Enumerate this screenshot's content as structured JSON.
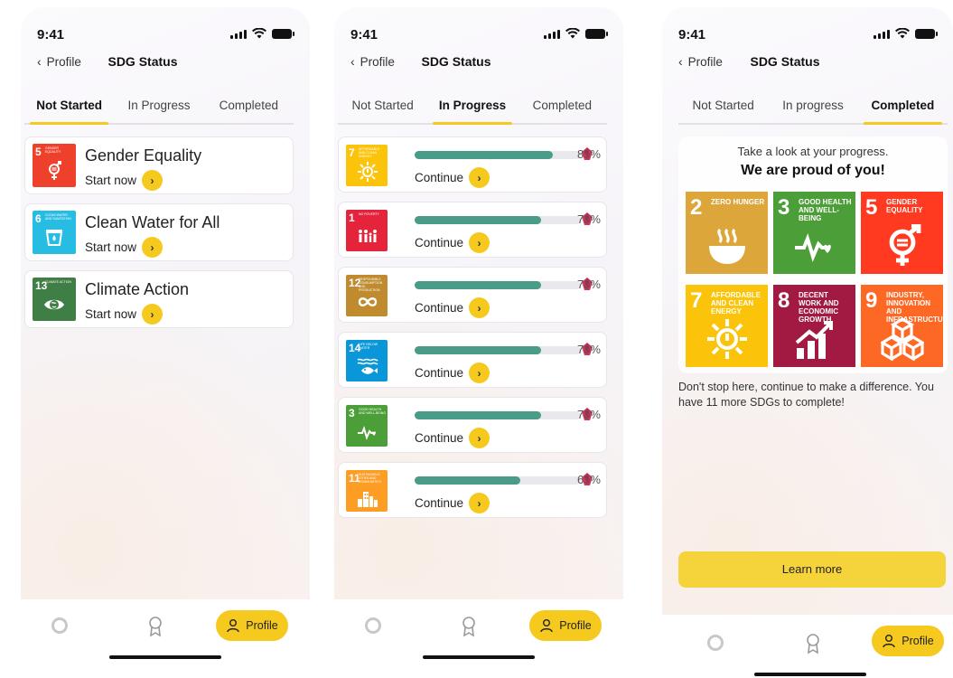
{
  "status": {
    "time": "9:41"
  },
  "nav": {
    "back_label": "Profile",
    "title": "SDG Status"
  },
  "tabs": [
    "Not Started",
    "In Progress",
    "Completed"
  ],
  "tabs_completed_screen": [
    "Not Started",
    "In progress",
    "Completed"
  ],
  "colors": {
    "accent": "#f5c91d",
    "progress": "#4a9c89"
  },
  "not_started": [
    {
      "num": "5",
      "tile_text": "Gender Equality",
      "title": "Gender Equality",
      "action": "Start now",
      "color": "#ef402b",
      "icon": "gender-icon"
    },
    {
      "num": "6",
      "tile_text": "Clean Water and Sanitation",
      "title": "Clean Water for All",
      "action": "Start now",
      "color": "#27bde2",
      "icon": "water-icon"
    },
    {
      "num": "13",
      "tile_text": "Climate Action",
      "title": "Climate Action",
      "action": "Start now",
      "color": "#3f7e44",
      "icon": "eye-globe-icon"
    }
  ],
  "in_progress": [
    {
      "num": "7",
      "tile_text": "Affordable and Clean Energy",
      "percent_label": "85%",
      "progress": 0.85,
      "action": "Continue",
      "color": "#fcc30b",
      "icon": "sun-icon"
    },
    {
      "num": "1",
      "tile_text": "No Poverty",
      "percent_label": "78%",
      "progress": 0.78,
      "action": "Continue",
      "color": "#e5243b",
      "icon": "family-icon"
    },
    {
      "num": "12",
      "tile_text": "Responsible Consumption and Production",
      "percent_label": "78%",
      "progress": 0.78,
      "action": "Continue",
      "color": "#bf8b2e",
      "icon": "infinity-icon"
    },
    {
      "num": "14",
      "tile_text": "Life Below Water",
      "percent_label": "78%",
      "progress": 0.78,
      "action": "Continue",
      "color": "#0a97d9",
      "icon": "fish-icon"
    },
    {
      "num": "3",
      "tile_text": "Good Health and Well-Being",
      "percent_label": "78%",
      "progress": 0.78,
      "action": "Continue",
      "color": "#4c9f38",
      "icon": "heartbeat-icon"
    },
    {
      "num": "11",
      "tile_text": "Sustainable Cities and Communities",
      "percent_label": "65%",
      "progress": 0.65,
      "action": "Continue",
      "color": "#fd9d24",
      "icon": "city-icon"
    }
  ],
  "completed": {
    "line1": "Take a look at your progress.",
    "line2": "We are proud of you!",
    "tiles": [
      {
        "num": "2",
        "text": "Zero Hunger",
        "color": "#dda63a",
        "icon": "bowl-icon"
      },
      {
        "num": "3",
        "text": "Good Health and Well-Being",
        "color": "#4c9f38",
        "icon": "heartbeat-icon"
      },
      {
        "num": "5",
        "text": "Gender Equality",
        "color": "#ff3a21",
        "icon": "gender-icon"
      },
      {
        "num": "7",
        "text": "Affordable and Clean Energy",
        "color": "#fcc30b",
        "icon": "sun-icon"
      },
      {
        "num": "8",
        "text": "Decent Work and Economic Growth",
        "color": "#a21942",
        "icon": "growth-chart-icon"
      },
      {
        "num": "9",
        "text": "Industry, Innovation and Infrastructure",
        "color": "#fd6925",
        "icon": "cubes-icon"
      }
    ],
    "note": "Don't stop here, continue to make a difference. You have 11 more SDGs to complete!",
    "button": "Learn more"
  },
  "bottom_tabs": {
    "profile_label": "Profile"
  }
}
